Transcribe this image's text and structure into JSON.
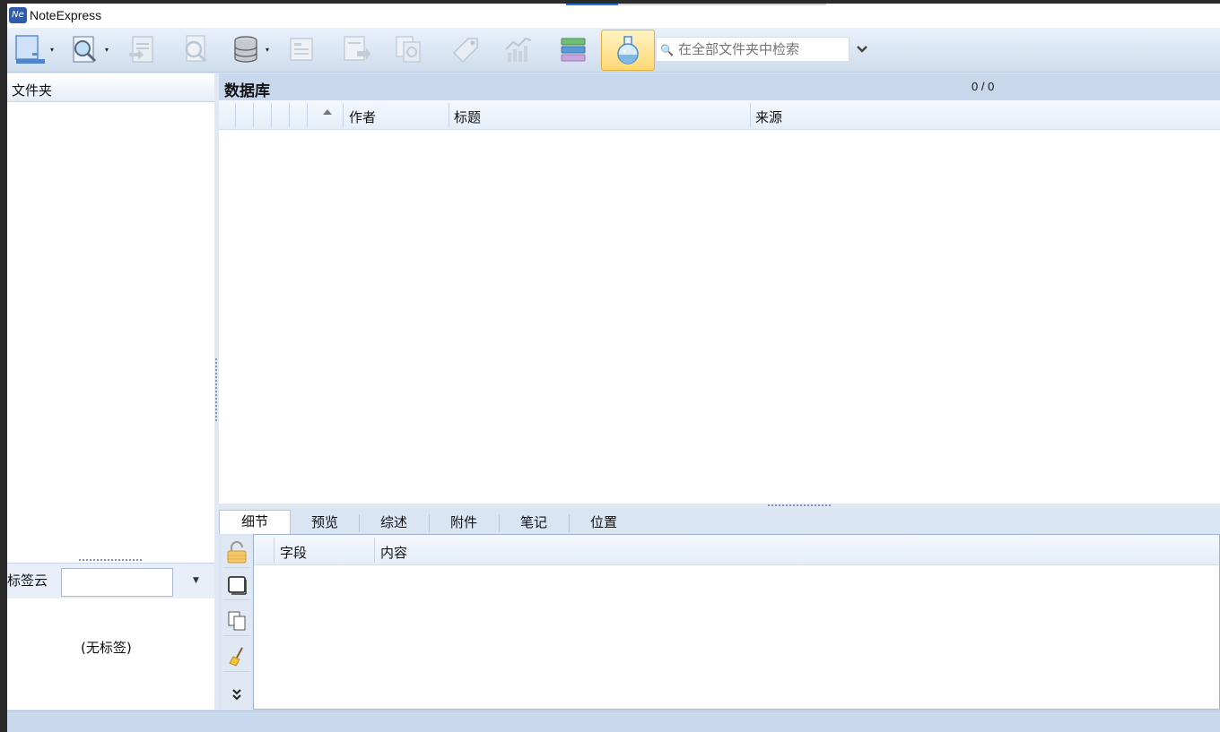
{
  "app": {
    "title": "NoteExpress",
    "icon_text": "Ne"
  },
  "toolbar": {
    "buttons": [
      {
        "name": "new-library-button",
        "icon": "library-icon"
      },
      {
        "name": "online-search-button",
        "icon": "magnifier-doc-icon"
      },
      {
        "name": "import-button",
        "icon": "import-doc-icon"
      },
      {
        "name": "find-fulltext-button",
        "icon": "find-doc-icon"
      },
      {
        "name": "database-button",
        "icon": "database-icon"
      },
      {
        "name": "cite-button",
        "icon": "cite-doc-icon"
      },
      {
        "name": "export-button",
        "icon": "export-doc-icon"
      },
      {
        "name": "duplicates-button",
        "icon": "duplicate-doc-icon"
      },
      {
        "name": "tag-button",
        "icon": "tag-icon"
      },
      {
        "name": "analysis-button",
        "icon": "chart-icon"
      },
      {
        "name": "layers-button",
        "icon": "layers-icon"
      },
      {
        "name": "lab-button",
        "icon": "flask-icon"
      }
    ],
    "search_placeholder": "在全部文件夹中检索"
  },
  "folders": {
    "header": "文件夹"
  },
  "tags": {
    "label": "标签云",
    "empty_text": "(无标签)"
  },
  "database": {
    "title": "数据库",
    "count": "0 / 0",
    "columns": [
      "作者",
      "标题",
      "来源"
    ]
  },
  "detail": {
    "tabs": [
      "细节",
      "预览",
      "综述",
      "附件",
      "笔记",
      "位置"
    ],
    "active_tab": "细节",
    "columns": [
      "字段",
      "内容"
    ]
  },
  "colors": {
    "accent": "#1e7ad6",
    "header_bg": "#c7d8ec",
    "window_bg": "#d9e5f3"
  }
}
